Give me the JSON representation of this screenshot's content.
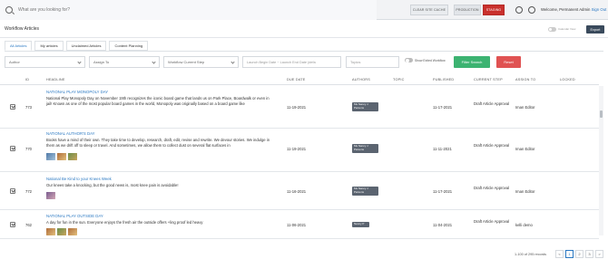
{
  "topbar": {
    "search_placeholder": "What are you looking for?",
    "clear_cache": "CLEAR SITE CACHE",
    "production": "PRODUCTION",
    "staging": "STAGING",
    "welcome": "Welcome, Permanent Admin",
    "sign_out": "Sign Out"
  },
  "header": {
    "title": "Workflow Articles",
    "toggle_label": "Calendar View",
    "export": "Export"
  },
  "tabs": [
    "All Articles",
    "My articles",
    "Unclaimed Articles",
    "Content Planning"
  ],
  "filters": {
    "author": "Author",
    "assign_to": "Assign To",
    "workflow": "Workflow Current Step",
    "dates": "Launch Begin Date  ~  Launch End Date (defa",
    "topics": "Topics",
    "show_exited": "Show Exited Workflow",
    "filter_search": "Filter Search",
    "reset": "Reset"
  },
  "table": {
    "columns": [
      "ID",
      "HEADLINE",
      "DUE DATE",
      "AUTHORS",
      "TOPIC",
      "PUBLISHED",
      "CURRENT STEP",
      "ASSIGN TO",
      "LOCKED"
    ],
    "rows": [
      {
        "id": "773",
        "headline": "NATIONAL PLAY MONOPOLY DAY",
        "description": "National Play Monopoly Day on November 19th recognizes the iconic board game that lands us on Park Place, Boardwalk or even in jail! Known as one of the most popular board games in the world, Monopoly was originally based on a board game like",
        "due_date": "11-19-2021",
        "author": "Ms Nancy J Parsons",
        "published": "11-17-2021",
        "current_step": "Draft Article Approval",
        "assign_to": "Iman Editor"
      },
      {
        "id": "770",
        "headline": "NATIONAL AUTHOR'S DAY",
        "description": "Books have a mind of their own. They take time to develop, research, draft, edit, revise and rewrite. We devour stories. We indulge in them as we drift off to sleep or travel. And sometimes, we allow them to collect dust on several flat surfaces in",
        "due_date": "11-19-2021",
        "author": "Ms Nancy J Parsons",
        "published": "11-11-2021",
        "current_step": "Draft Article Approval",
        "assign_to": "Iman Editor"
      },
      {
        "id": "772",
        "headline": "National Be Kind to your Knees Week",
        "description": "Our knees take a knocking, but the good news is, most knee pain is avoidable!",
        "due_date": "11-16-2021",
        "author": "Ms Nancy J Parsons",
        "published": "11-17-2021",
        "current_step": "Draft Article Approval",
        "assign_to": "Iman Editor"
      },
      {
        "id": "762",
        "headline": "NATIONAL PLAY OUTSIDE DAY",
        "description": "A day for fun in the sun. Everyone enjoys the fresh air the outside offers +ling proof led heavy",
        "due_date": "11-06-2021",
        "author": "Nancy P",
        "published": "11-04-2021",
        "current_step": "Draft Article Approval",
        "assign_to": "kelli demo"
      }
    ]
  },
  "pagination": {
    "info": "1-100 of 295 records",
    "prev": "<",
    "pages": [
      "1",
      "2",
      "3"
    ],
    "next": ">"
  }
}
